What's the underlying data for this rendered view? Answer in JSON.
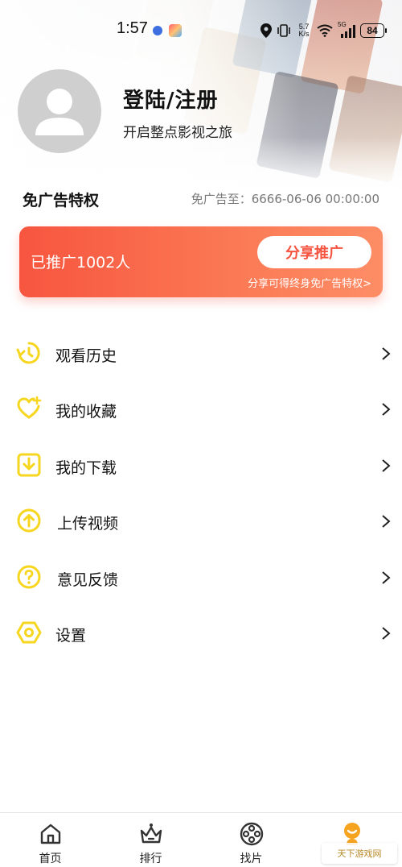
{
  "status_bar": {
    "time": "1:57",
    "speed_top": "5.7",
    "speed_bottom": "K/s",
    "network": "5G",
    "battery": "84"
  },
  "profile": {
    "title": "登陆/注册",
    "subtitle": "开启整点影视之旅"
  },
  "ad_free": {
    "title": "免广告特权",
    "expiry": "免广告至：6666-06-06 00:00:00"
  },
  "promo": {
    "count_text": "已推广1002人",
    "share_button": "分享推广",
    "hint": "分享可得终身免广告特权>"
  },
  "menu": [
    {
      "label": "观看历史",
      "icon": "history-icon"
    },
    {
      "label": "我的收藏",
      "icon": "favorite-heart-icon"
    },
    {
      "label": "我的下载",
      "icon": "download-icon"
    },
    {
      "label": "上传视频",
      "icon": "upload-icon"
    },
    {
      "label": "意见反馈",
      "icon": "question-icon"
    },
    {
      "label": "设置",
      "icon": "settings-hexagon-icon"
    }
  ],
  "bottom_nav": [
    {
      "label": "首页",
      "icon": "home-icon"
    },
    {
      "label": "排行",
      "icon": "ranking-crown-icon"
    },
    {
      "label": "找片",
      "icon": "film-reel-icon"
    },
    {
      "label": "",
      "icon": "profile-icon",
      "active": true
    }
  ],
  "watermark": "天下游戏网",
  "colors": {
    "accent": "#F6D61F",
    "promo_start": "#F7553F",
    "promo_end": "#FD8D66",
    "share_text": "#F6533F"
  }
}
